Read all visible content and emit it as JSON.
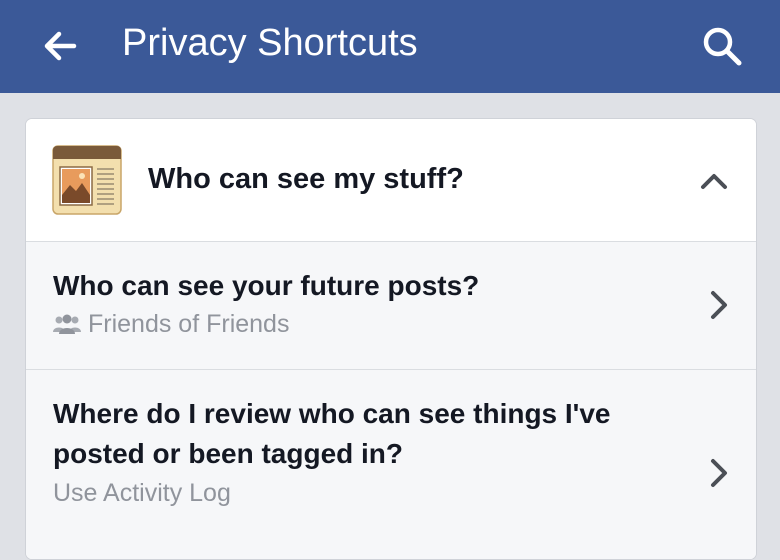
{
  "app_bar": {
    "title": "Privacy Shortcuts",
    "back_icon": "arrow-left-icon",
    "search_icon": "search-icon",
    "background_color": "#3b5998"
  },
  "section": {
    "title": "Who can see my stuff?",
    "icon": "news-photo-icon",
    "expanded": true,
    "collapse_icon": "chevron-up-icon"
  },
  "rows": [
    {
      "title": "Who can see your future posts?",
      "subtitle": "Friends of Friends",
      "subtitle_icon": "friends-icon",
      "chevron_icon": "chevron-right-icon"
    },
    {
      "title": "Where do I review who can see things I've posted or been tagged in?",
      "subtitle": "Use Activity Log",
      "chevron_icon": "chevron-right-icon"
    }
  ]
}
